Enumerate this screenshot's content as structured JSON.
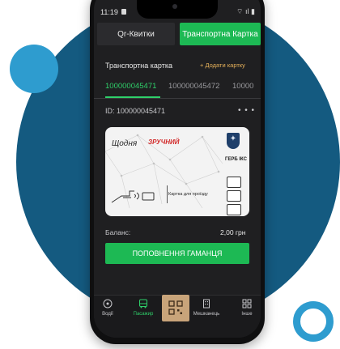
{
  "status_bar": {
    "time": "11:19",
    "right_icons": "⌔ ıl ▮"
  },
  "tabs": {
    "qr": "Qr-Квитки",
    "transport": "Транспортна Картка"
  },
  "section": {
    "title": "Транспортна картка",
    "add_card": "+ Додати картку"
  },
  "card_tabs": [
    "100000045471",
    "100000045472",
    "10000"
  ],
  "card": {
    "id_label": "ID: 100000045471",
    "more": "• • •",
    "brand_part1": "Щодня",
    "brand_part2": "ЗРУЧНИЙ",
    "caption": "Картка для проїзду",
    "city_logo": "ГЕРБ ІКС"
  },
  "balance": {
    "label": "Баланс:",
    "value": "2,00 грн"
  },
  "topup_button": "ПОПОВНЕННЯ ГАМАНЦЯ",
  "nav": {
    "driver": "Водії",
    "transport": "Пасажир",
    "city": "Мешканець",
    "more": "Інше"
  },
  "colors": {
    "accent": "#1db954",
    "link": "#e6b15a",
    "bg_circle": "#145a80",
    "light_circle": "#2e9ccf",
    "qr_nav_bg": "#c8a47a"
  }
}
